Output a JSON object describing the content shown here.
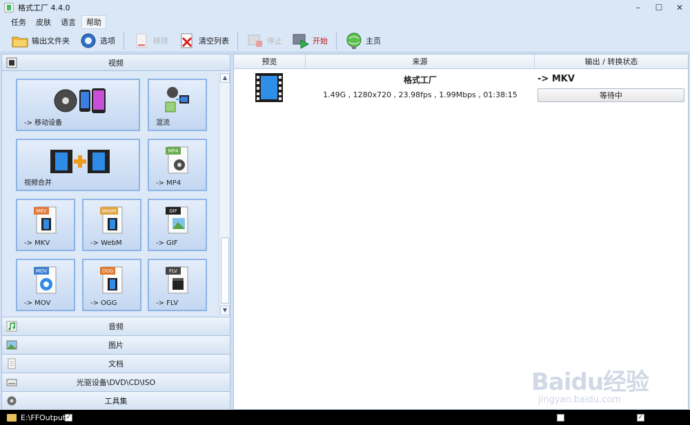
{
  "window": {
    "title": "格式工厂 4.4.0"
  },
  "menu": [
    "任务",
    "皮肤",
    "语言",
    "帮助"
  ],
  "toolbar": {
    "output_folder": "输出文件夹",
    "options": "选项",
    "remove": "移除",
    "clear_list": "清空列表",
    "stop": "停止",
    "start": "开始",
    "home": "主页"
  },
  "left": {
    "video_category": "视频",
    "tiles": [
      "-> 移动设备",
      "混流",
      "视频合并",
      "-> MP4",
      "-> MKV",
      "-> WebM",
      "-> GIF",
      "-> MOV",
      "-> OGG",
      "-> FLV"
    ],
    "tile_badges": {
      "mp4": "MP4",
      "mkv": "MKV",
      "webm": "WebM",
      "gif": "GIF",
      "mov": "MOV",
      "ogg": "OGG",
      "flv": "FLV"
    },
    "categories": [
      "音频",
      "图片",
      "文档",
      "光驱设备\\DVD\\CD\\ISO",
      "工具集"
    ]
  },
  "table": {
    "headers": [
      "预览",
      "来源",
      "输出 / 转换状态"
    ],
    "rows": [
      {
        "source_name": "格式工厂",
        "source_info": "1.49G , 1280x720 , 23.98fps , 1.99Mbps , 01:38:15",
        "output": "-> MKV",
        "status": "等待中"
      }
    ]
  },
  "statusbar": {
    "path": "E:\\FFOutput"
  },
  "watermark": {
    "main": "Baidu经验",
    "sub": "jingyan.baidu.com"
  },
  "colors": {
    "accent": "#8db3e6",
    "start_red": "#c21a1a",
    "pane_bg": "#dde9f7"
  }
}
